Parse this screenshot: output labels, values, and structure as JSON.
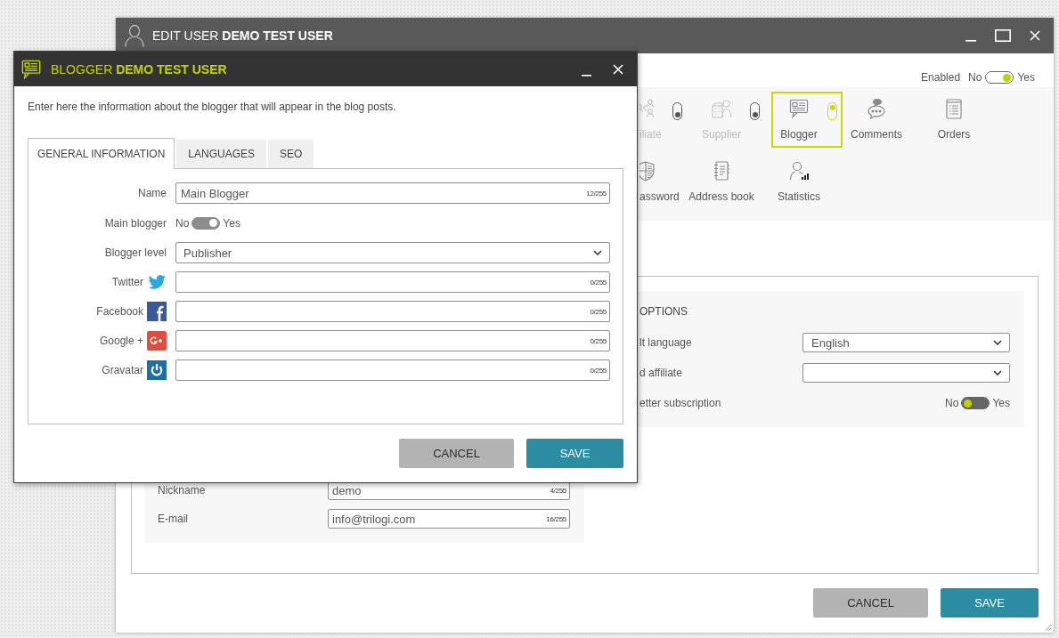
{
  "edit_user_window": {
    "title": "EDIT USER **DEMO TEST USER**",
    "enabled": {
      "label": "Enabled",
      "off_label": "No",
      "on_label": "Yes",
      "on": true
    },
    "roles": [
      {
        "kind": "affiliate",
        "label": "iliate",
        "selected": false,
        "on": false
      },
      {
        "kind": "supplier",
        "label": "Supplier",
        "selected": false,
        "on": false
      },
      {
        "kind": "blogger",
        "label": "Blogger",
        "selected": true,
        "on": true
      },
      {
        "kind": "comments",
        "label": "Comments",
        "selected": false
      },
      {
        "kind": "orders",
        "label": "Orders",
        "selected": false
      },
      {
        "kind": "password",
        "label": "assword",
        "selected": false
      },
      {
        "kind": "addressbook",
        "label": "Address book",
        "selected": false
      },
      {
        "kind": "statistics",
        "label": "Statistics",
        "selected": false
      }
    ],
    "account_fields": [
      {
        "label": "Nickname",
        "value": "demo",
        "counter": "4/255"
      },
      {
        "label": "E-mail",
        "value": "info@trilogi.com",
        "counter": "16/255"
      }
    ],
    "options": {
      "title": "OPTIONS",
      "fields": [
        {
          "kind": "select",
          "label": "lt language",
          "value": "English"
        },
        {
          "kind": "select",
          "label": "d affiliate"
        },
        {
          "kind": "toggle",
          "label": "etter subscription",
          "off_label": "No",
          "on_label": "Yes",
          "on": false
        }
      ]
    },
    "buttons": [
      {
        "kind": "cancel",
        "label": "CANCEL"
      },
      {
        "kind": "save",
        "label": "SAVE"
      }
    ]
  },
  "blogger_dialog": {
    "title": "BLOGGER **DEMO TEST USER**",
    "description": "Enter here the information about the blogger that will appear in the blog posts.",
    "tabs": [
      {
        "label": "GENERAL INFORMATION",
        "selected": true
      },
      {
        "label": "LANGUAGES",
        "selected": false
      },
      {
        "label": "SEO",
        "selected": false
      }
    ],
    "fields": [
      {
        "kind": "text",
        "label": "Name",
        "value": "Main Blogger",
        "counter": "12/255"
      },
      {
        "kind": "toggle",
        "label": "Main blogger",
        "off_label": "No",
        "on_label": "Yes",
        "on": true,
        "disabled": true
      },
      {
        "kind": "select",
        "label": "Blogger level",
        "value": "Publisher"
      },
      {
        "kind": "twitter",
        "label": "Twitter",
        "counter": "0/255"
      },
      {
        "kind": "facebook",
        "label": "Facebook",
        "counter": "0/255"
      },
      {
        "kind": "google",
        "label": "Google +",
        "counter": "0/255"
      },
      {
        "kind": "gravatar",
        "label": "Gravatar",
        "counter": "0/255"
      }
    ],
    "buttons": [
      {
        "kind": "cancel",
        "label": "CANCEL"
      },
      {
        "kind": "save",
        "label": "SAVE"
      }
    ]
  }
}
